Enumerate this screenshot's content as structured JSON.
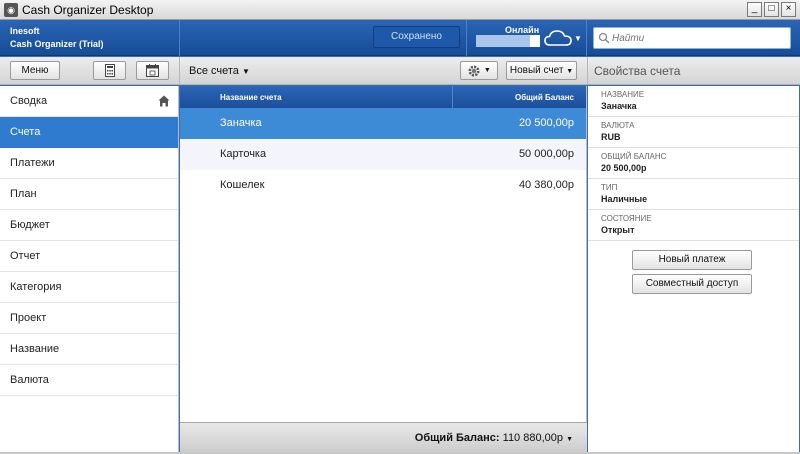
{
  "window": {
    "title": "Cash Organizer Desktop",
    "minimize": "_",
    "maximize": "□",
    "close": "×"
  },
  "header": {
    "company": "Inesoft",
    "product": "Cash Organizer (Trial)",
    "saved_label": "Сохранено",
    "online_label": "Онлайн",
    "search_placeholder": "Найти"
  },
  "toolbar": {
    "menu_label": "Меню",
    "accounts_filter": "Все счета",
    "new_account_label": "Новый счет",
    "props_title": "Свойства счета"
  },
  "sidebar": {
    "items": [
      {
        "label": "Сводка"
      },
      {
        "label": "Счета"
      },
      {
        "label": "Платежи"
      },
      {
        "label": "План"
      },
      {
        "label": "Бюджет"
      },
      {
        "label": "Отчет"
      },
      {
        "label": "Категория"
      },
      {
        "label": "Проект"
      },
      {
        "label": "Название"
      },
      {
        "label": "Валюта"
      }
    ],
    "active_index": 1
  },
  "grid": {
    "col_name": "Название счета",
    "col_balance": "Общий Баланс",
    "rows": [
      {
        "name": "Заначка",
        "balance": "20 500,00р"
      },
      {
        "name": "Карточка",
        "balance": "50 000,00р"
      },
      {
        "name": "Кошелек",
        "balance": "40 380,00р"
      }
    ],
    "selected_index": 0,
    "total_label": "Общий Баланс:",
    "total_value": "110 880,00р"
  },
  "props": {
    "fields": [
      {
        "label": "НАЗВАНИЕ",
        "value": "Заначка"
      },
      {
        "label": "ВАЛЮТА",
        "value": "RUB"
      },
      {
        "label": "ОБЩИЙ БАЛАНС",
        "value": "20 500,00р"
      },
      {
        "label": "ТИП",
        "value": "Наличные"
      },
      {
        "label": "СОСТОЯНИЕ",
        "value": "Открыт"
      }
    ],
    "new_payment_label": "Новый платеж",
    "shared_access_label": "Совместный доступ"
  }
}
